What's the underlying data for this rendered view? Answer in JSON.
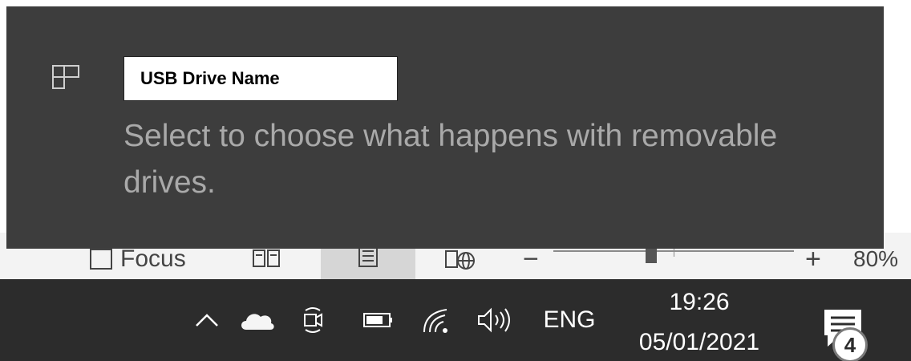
{
  "toast": {
    "app_icon": "drive-icon",
    "title": "USB Drive Name",
    "body": "Select to choose what happens with removable drives."
  },
  "word_status_bar": {
    "focus_label": "Focus",
    "read_mode_icon": "read-mode-icon",
    "print_layout_icon": "print-layout-icon",
    "web_layout_icon": "web-layout-icon",
    "zoom_minus": "−",
    "zoom_plus": "+",
    "zoom_level": "80%"
  },
  "taskbar": {
    "tray_icons": [
      "chevron-up-icon",
      "onedrive-cloud-icon",
      "meet-now-icon",
      "battery-icon",
      "wifi-icon",
      "volume-icon"
    ],
    "language": "ENG",
    "time": "19:26",
    "date": "05/01/2021",
    "notification_count": "4"
  },
  "colors": {
    "toast_bg": "#3d3d3d",
    "taskbar_bg": "#2c2c2c",
    "toast_body_text": "#a9a9a9"
  }
}
